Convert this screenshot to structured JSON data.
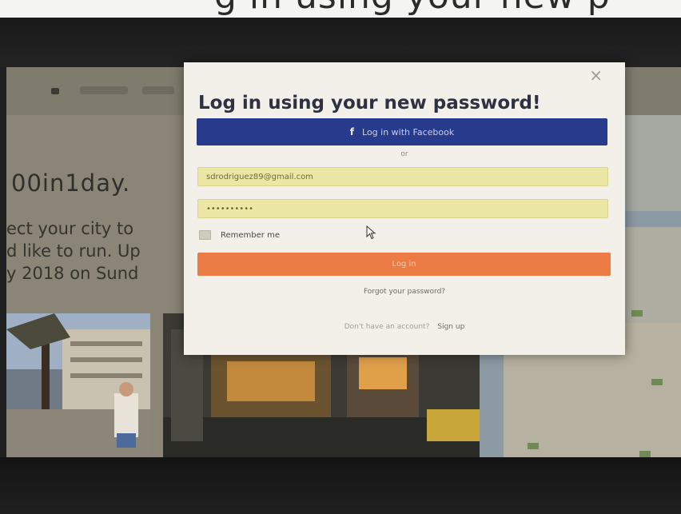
{
  "caption": {
    "text": "g in using your new p"
  },
  "background_page": {
    "hero_title": "00in1day.",
    "hero_lines": [
      "ect your city to",
      "d like to run. Up",
      "y 2018 on Sund"
    ]
  },
  "modal": {
    "title": "Log in using your new password!",
    "close_icon": "×",
    "facebook_button": {
      "icon": "f",
      "label": "Log in with Facebook"
    },
    "or_text": "or",
    "email_field": {
      "value": "sdrodriguez89@gmail.com"
    },
    "password_field": {
      "value": "••••••••••"
    },
    "remember_label": "Remember me",
    "login_label": "Log in",
    "forgot_link": "Forgot your password?",
    "signup_prompt": "Don't have an account?",
    "signup_link": "Sign up"
  },
  "colors": {
    "facebook": "#283a8c",
    "login": "#ec7c45",
    "field_autofill": "#ece7a4",
    "modal_bg": "#f2f0e8"
  }
}
